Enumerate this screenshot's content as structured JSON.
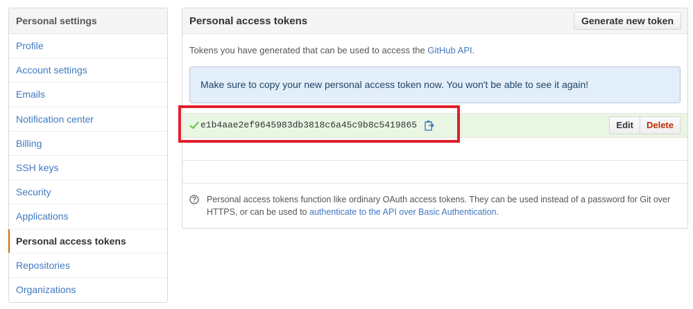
{
  "sidebar": {
    "header": "Personal settings",
    "items": [
      {
        "label": "Profile"
      },
      {
        "label": "Account settings"
      },
      {
        "label": "Emails"
      },
      {
        "label": "Notification center"
      },
      {
        "label": "Billing"
      },
      {
        "label": "SSH keys"
      },
      {
        "label": "Security"
      },
      {
        "label": "Applications"
      },
      {
        "label": "Personal access tokens"
      },
      {
        "label": "Repositories"
      },
      {
        "label": "Organizations"
      }
    ],
    "selected_index": 8
  },
  "main": {
    "title": "Personal access tokens",
    "generate_button": "Generate new token",
    "intro_prefix": "Tokens you have generated that can be used to access the ",
    "intro_link": "GitHub API",
    "intro_suffix": ".",
    "flash_message": "Make sure to copy your new personal access token now. You won't be able to see it again!",
    "token": {
      "value": "e1b4aae2ef9645983db3818c6a45c9b8c5419865",
      "edit_label": "Edit",
      "delete_label": "Delete"
    },
    "help": {
      "text_prefix": "Personal access tokens function like ordinary OAuth access tokens. They can be used instead of a password for Git over HTTPS, or can be used to ",
      "link": "authenticate to the API over Basic Authentication",
      "text_suffix": "."
    }
  },
  "colors": {
    "link": "#4078c0",
    "selected_accent": "#d26911",
    "flash_bg": "#e2eef9",
    "token_row_bg": "#e9f6e4",
    "check_green": "#6cc644",
    "delete_red": "#bd2c00",
    "highlight_red": "#e0202a"
  },
  "icons": {
    "check": "check-icon",
    "clipboard": "clipboard-icon",
    "help": "question-icon"
  }
}
